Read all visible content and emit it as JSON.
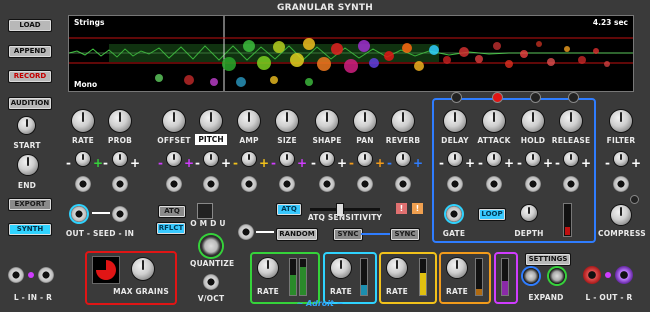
{
  "title": "GRANULAR SYNTH",
  "scope": {
    "sample_name": "Strings",
    "duration": "4.23 sec",
    "channel_mode": "Mono"
  },
  "left_buttons": {
    "load": "LOAD",
    "append": "APPEND",
    "record": "RECORD",
    "audition": "AUDITION",
    "export": "EXPORT",
    "synth": "SYNTH"
  },
  "left_labels": {
    "start": "START",
    "end": "END",
    "lr_in": "L - IN - R"
  },
  "knob_labels": {
    "rate": "RATE",
    "prob": "PROB",
    "offset": "OFFSET",
    "pitch": "PITCH",
    "amp": "AMP",
    "size": "SIZE",
    "shape": "SHAPE",
    "pan": "PAN",
    "reverb": "REVERB",
    "delay": "DELAY",
    "attack": "ATTACK",
    "hold": "HOLD",
    "release": "RELEASE",
    "filter": "FILTER",
    "compress": "COMPRESS"
  },
  "controls": {
    "atq": "ATQ",
    "atq2": "ATQ",
    "omdu": "O M D U",
    "rflct": "RFLCT",
    "atq_sensitivity": "ATQ SENSITIVITY",
    "warn1": "!",
    "warn2": "!",
    "out_seed_in": "OUT - SEED - IN",
    "random": "RANDOM",
    "sync1": "SYNC",
    "sync2": "SYNC",
    "loop": "LOOP",
    "gate": "GATE",
    "depth": "DEPTH",
    "quantize": "QUANTIZE",
    "voct": "V/OCT",
    "max_grains": "MAX GRAINS",
    "settings": "SETTINGS",
    "expand": "EXPAND",
    "lr_out": "L - OUT - R",
    "brand": "~ Adroit ~"
  },
  "lfo_labels": {
    "rate1": "RATE",
    "rate2": "RATE",
    "rate3": "RATE",
    "rate4": "RATE"
  },
  "colors": {
    "accent_blue": "#2f7dff",
    "green": "#35d33a",
    "cyan": "#2fd3ff",
    "yellow": "#f2c21b",
    "orange": "#f29b1b",
    "magenta": "#d03cff",
    "red": "#e01515"
  }
}
